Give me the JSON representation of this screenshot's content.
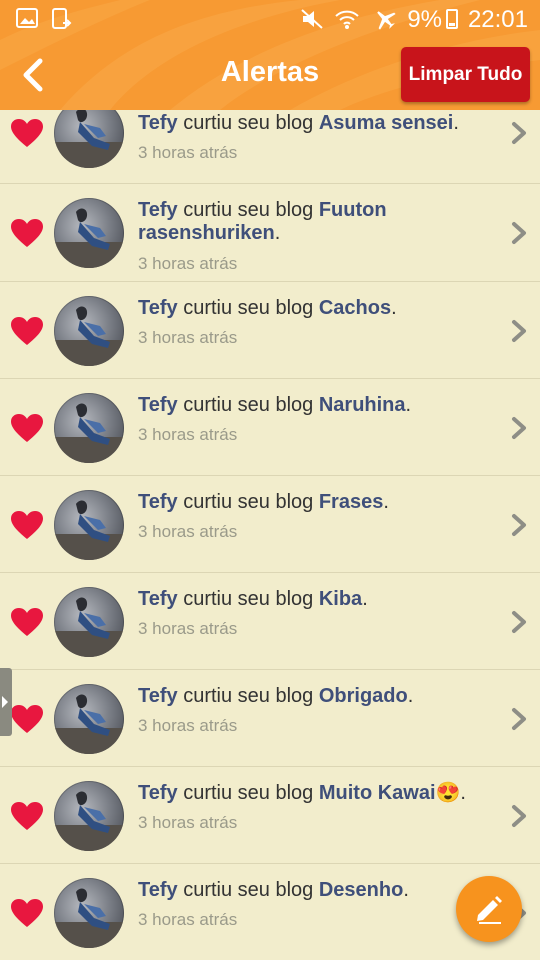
{
  "status_bar": {
    "battery_percent": "9%",
    "time": "22:01"
  },
  "header": {
    "title": "Alertas",
    "clear_all_label": "Limpar Tudo",
    "back_icon": "chevron-left-icon",
    "background_color": "#f79a33",
    "clear_button_color": "#c8141b"
  },
  "notifications": [
    {
      "user": "Tefy",
      "action": " curtiu seu blog ",
      "blog": "Asuma sensei",
      "end": ".",
      "time": "3 horas atrás"
    },
    {
      "user": "Tefy",
      "action": " curtiu seu blog ",
      "blog": "Fuuton rasenshuriken",
      "end": ".",
      "time": "3 horas atrás"
    },
    {
      "user": "Tefy",
      "action": " curtiu seu blog ",
      "blog": "Cachos",
      "end": ".",
      "time": "3 horas atrás"
    },
    {
      "user": "Tefy",
      "action": " curtiu seu blog ",
      "blog": "Naruhina",
      "end": ".",
      "time": "3 horas atrás"
    },
    {
      "user": "Tefy",
      "action": " curtiu seu blog ",
      "blog": "Frases",
      "end": ".",
      "time": "3 horas atrás"
    },
    {
      "user": "Tefy",
      "action": " curtiu seu blog ",
      "blog": "Kiba",
      "end": ".",
      "time": "3 horas atrás"
    },
    {
      "user": "Tefy",
      "action": " curtiu seu blog ",
      "blog": "Obrigado",
      "end": ".",
      "time": "3 horas atrás"
    },
    {
      "user": "Tefy",
      "action": " curtiu seu blog ",
      "blog": "Muito Kawai😍",
      "end": ".",
      "time": "3 horas atrás"
    },
    {
      "user": "Tefy",
      "action": " curtiu seu blog ",
      "blog": "Desenho",
      "end": ".",
      "time": "3 horas atrás"
    }
  ],
  "fab_icon": "pencil-icon",
  "heart_color": "#e8173f",
  "link_color": "#3f4f7a"
}
